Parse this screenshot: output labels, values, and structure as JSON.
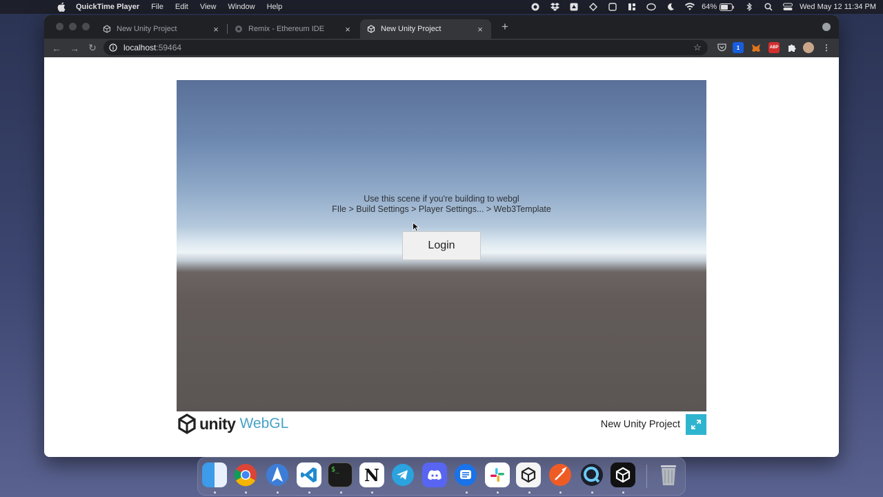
{
  "menubar": {
    "app_name": "QuickTime Player",
    "menus": [
      "File",
      "Edit",
      "View",
      "Window",
      "Help"
    ],
    "battery": "64%",
    "datetime": "Wed May 12  11:34 PM"
  },
  "browser": {
    "tabs": [
      {
        "title": "New Unity Project",
        "icon": "unity-icon",
        "active": false
      },
      {
        "title": "Remix - Ethereum IDE",
        "icon": "remix-icon",
        "active": false
      },
      {
        "title": "New Unity Project",
        "icon": "unity-icon",
        "active": true
      }
    ],
    "address": {
      "host": "localhost",
      "port": ":59464"
    },
    "extensions": [
      "pocket-icon",
      "bitwarden-icon",
      "metamask-icon",
      "adblock-icon",
      "puzzle-icon",
      "profile-avatar"
    ],
    "extension_labels": {
      "adblock": "ABP",
      "bitwarden_badge": "1"
    }
  },
  "unity": {
    "scene_text_line1": "Use this scene if you're building to webgl",
    "scene_text_line2": "FIle > Build Settings > Player Settings... > Web3Template",
    "login_label": "Login",
    "logo_word": "unity",
    "logo_product": "WebGL",
    "project_title": "New Unity Project",
    "accent_color": "#2fb4cf"
  },
  "dock": {
    "apps": [
      "Finder",
      "Chrome",
      "Airmail",
      "Visual Studio Code",
      "Terminal",
      "Notion",
      "Telegram",
      "Discord",
      "Messages",
      "Slack",
      "Unity Hub",
      "Postman",
      "QuickTime Player",
      "Unity",
      "Trash"
    ],
    "terminal_label": "$_",
    "notion_label": "N"
  }
}
